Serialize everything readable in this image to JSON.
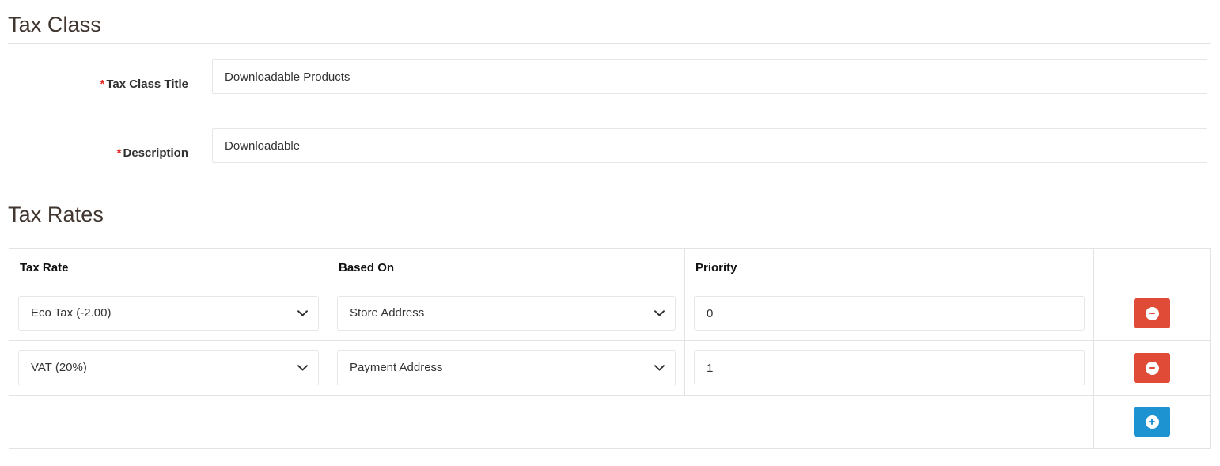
{
  "tax_class": {
    "section_title": "Tax Class",
    "fields": [
      {
        "label": "Tax Class Title",
        "required_marker": "*",
        "value": "Downloadable Products",
        "placeholder": ""
      },
      {
        "label": "Description",
        "required_marker": "*",
        "value": "Downloadable",
        "placeholder": ""
      }
    ]
  },
  "tax_rates": {
    "section_title": "Tax Rates",
    "columns": [
      "Tax Rate",
      "Based On",
      "Priority",
      ""
    ],
    "rows": [
      {
        "tax_rate": "Eco Tax (-2.00)",
        "based_on": "Store Address",
        "priority": "0",
        "delete_icon": "minus-circle-icon"
      },
      {
        "tax_rate": "VAT (20%)",
        "based_on": "Payment Address",
        "priority": "1",
        "delete_icon": "minus-circle-icon"
      }
    ],
    "add_row": {
      "add_icon": "plus-circle-icon"
    }
  },
  "colors": {
    "delete_button": "#e04b37",
    "add_button": "#1d93d2",
    "required_star": "#e02b27",
    "border": "#e3e3e3",
    "input_border": "#e6e6e6",
    "heading_text": "#41362f"
  }
}
